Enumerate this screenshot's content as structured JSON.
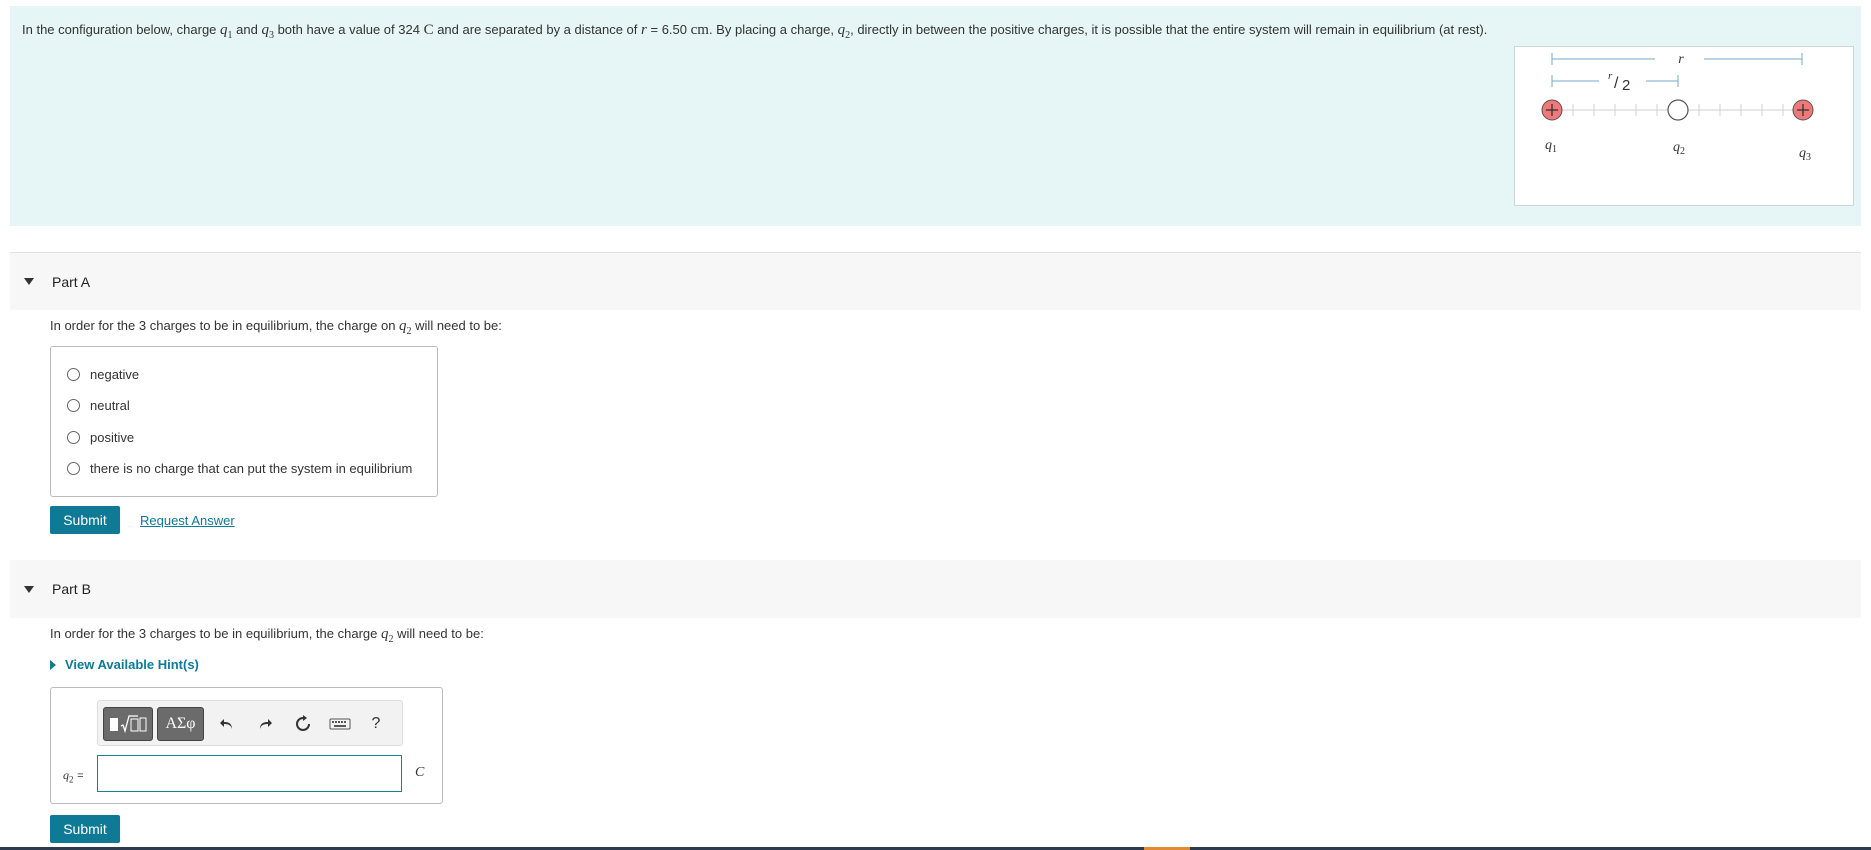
{
  "intro": {
    "text_1": "In the configuration below, charge ",
    "text_and": " and ",
    "text_2": " both have a value of 324 ",
    "unit_C": "C",
    "text_3": " and are separated by a distance of ",
    "distance_label": "= 6.50",
    "unit_cm": "cm",
    "text_4": ". By placing a charge, ",
    "text_5": ", directly in between the positive charges, it is possible that the entire system will remain in equilibrium (at rest).",
    "var_q": "q",
    "sub_1": "1",
    "sub_2": "2",
    "sub_3": "3",
    "var_r": "r"
  },
  "figure": {
    "label_r": "r",
    "label_half_num": "r",
    "label_half_den": "2",
    "charge_q1": "q1",
    "charge_q2": "q2",
    "charge_q3": "q3",
    "sub_1": "1",
    "sub_2": "2",
    "sub_3": "3",
    "var_q": "q",
    "charge_color": "#f07878"
  },
  "partA": {
    "title": "Part A",
    "prompt_1": "In order for the 3 charges to be in equilibrium, the charge on ",
    "prompt_2": " will need to be:",
    "choices": [
      "negative",
      "neutral",
      "positive",
      "there is no charge that can put the system in equilibrium"
    ],
    "submit_label": "Submit",
    "request_answer_label": "Request Answer"
  },
  "partB": {
    "title": "Part B",
    "prompt_1": "In order for the 3 charges to be in equilibrium, the charge ",
    "prompt_2": " will need to be:",
    "hints_label": "View Available Hint(s)",
    "greek_label": "ΑΣφ",
    "help_label": "?",
    "answer_label": "=",
    "answer_value": "",
    "unit": "C",
    "submit_label": "Submit"
  },
  "colors": {
    "accent": "#0e7a96",
    "intro_bg": "#e6f5f5"
  }
}
